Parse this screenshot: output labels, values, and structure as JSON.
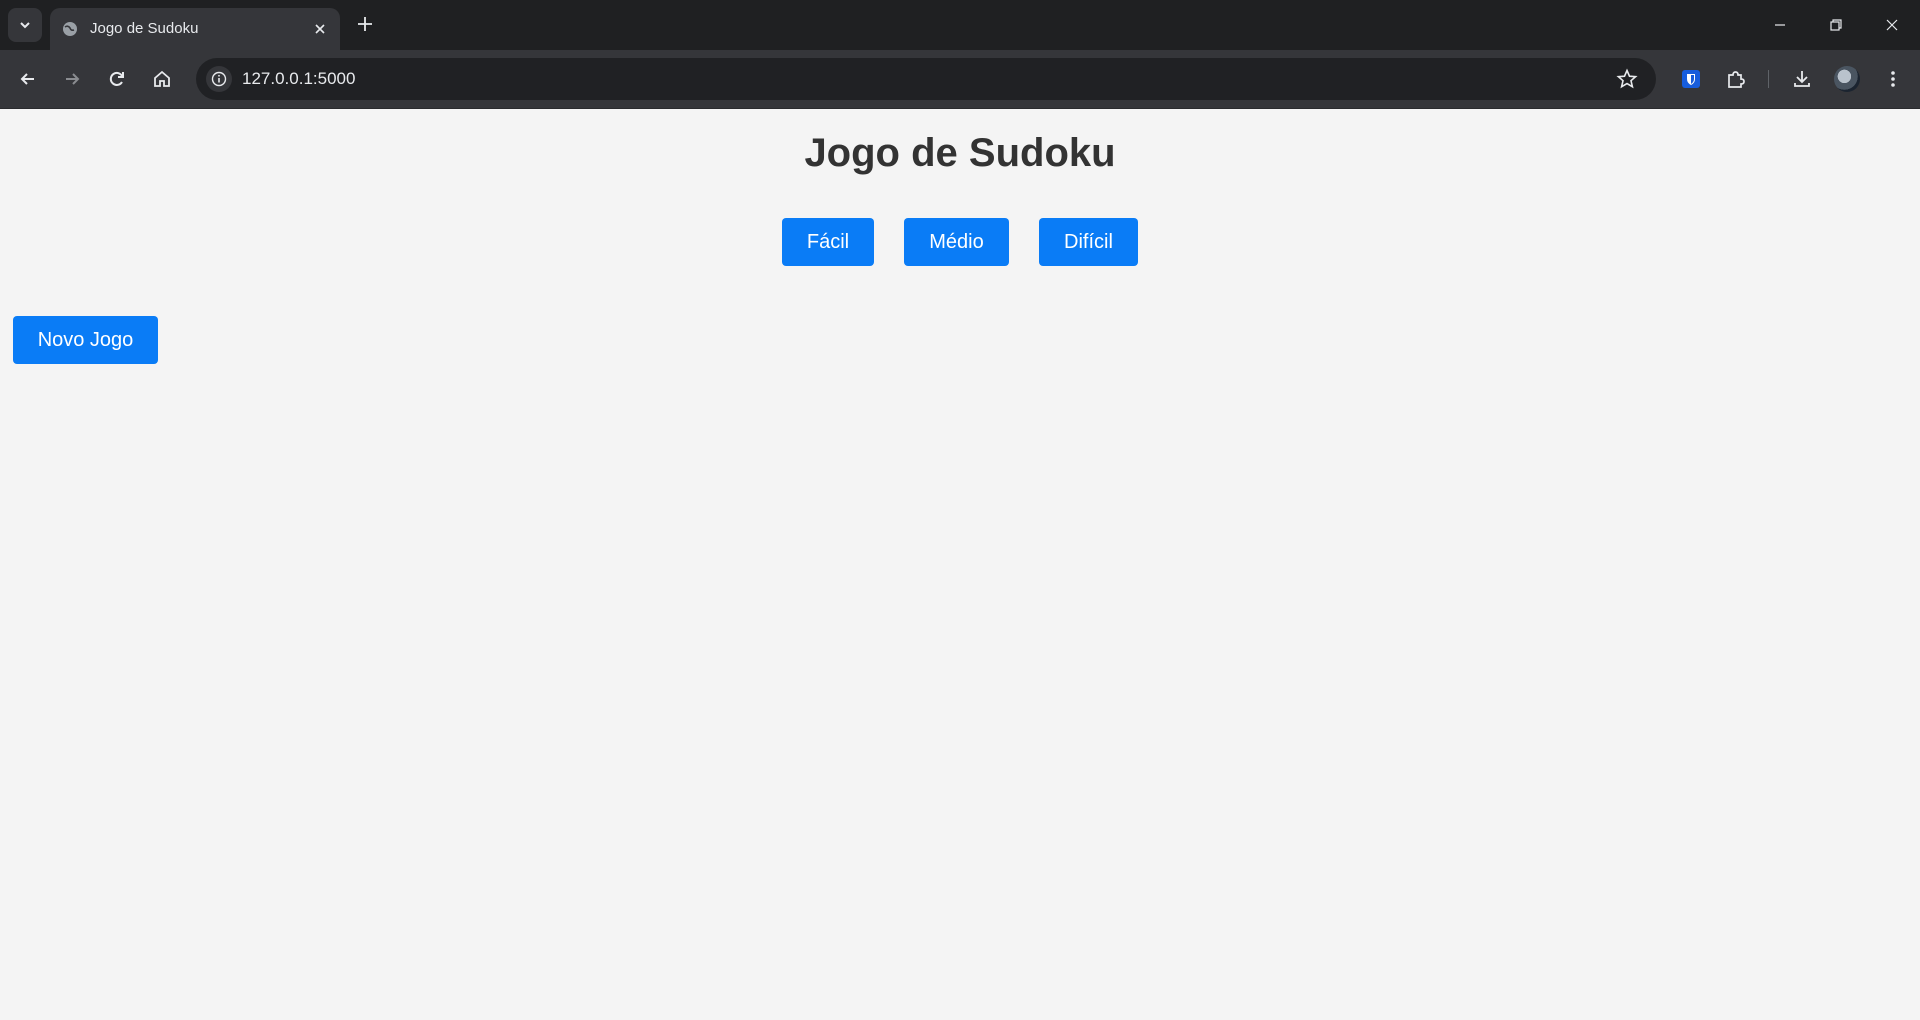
{
  "browser": {
    "tab": {
      "title": "Jogo de Sudoku",
      "favicon": "globe-icon"
    },
    "new_tab_icon": "plus-icon",
    "address_bar": {
      "url": "127.0.0.1:5000"
    },
    "icons": {
      "back": "arrow-left-icon",
      "forward": "arrow-right-icon",
      "reload": "reload-icon",
      "home": "home-icon",
      "site_info": "info-icon",
      "bookmark": "star-icon",
      "extension_shield": "shield-icon",
      "extensions": "puzzle-icon",
      "downloads": "download-icon",
      "menu": "kebab-menu-icon"
    }
  },
  "page": {
    "title": "Jogo de Sudoku",
    "difficulty_buttons": {
      "easy": "Fácil",
      "medium": "Médio",
      "hard": "Difícil"
    },
    "new_game_button": "Novo Jogo"
  },
  "colors": {
    "button_bg": "#0a7cf6",
    "page_bg": "#f4f4f4",
    "title_text": "#333333"
  }
}
